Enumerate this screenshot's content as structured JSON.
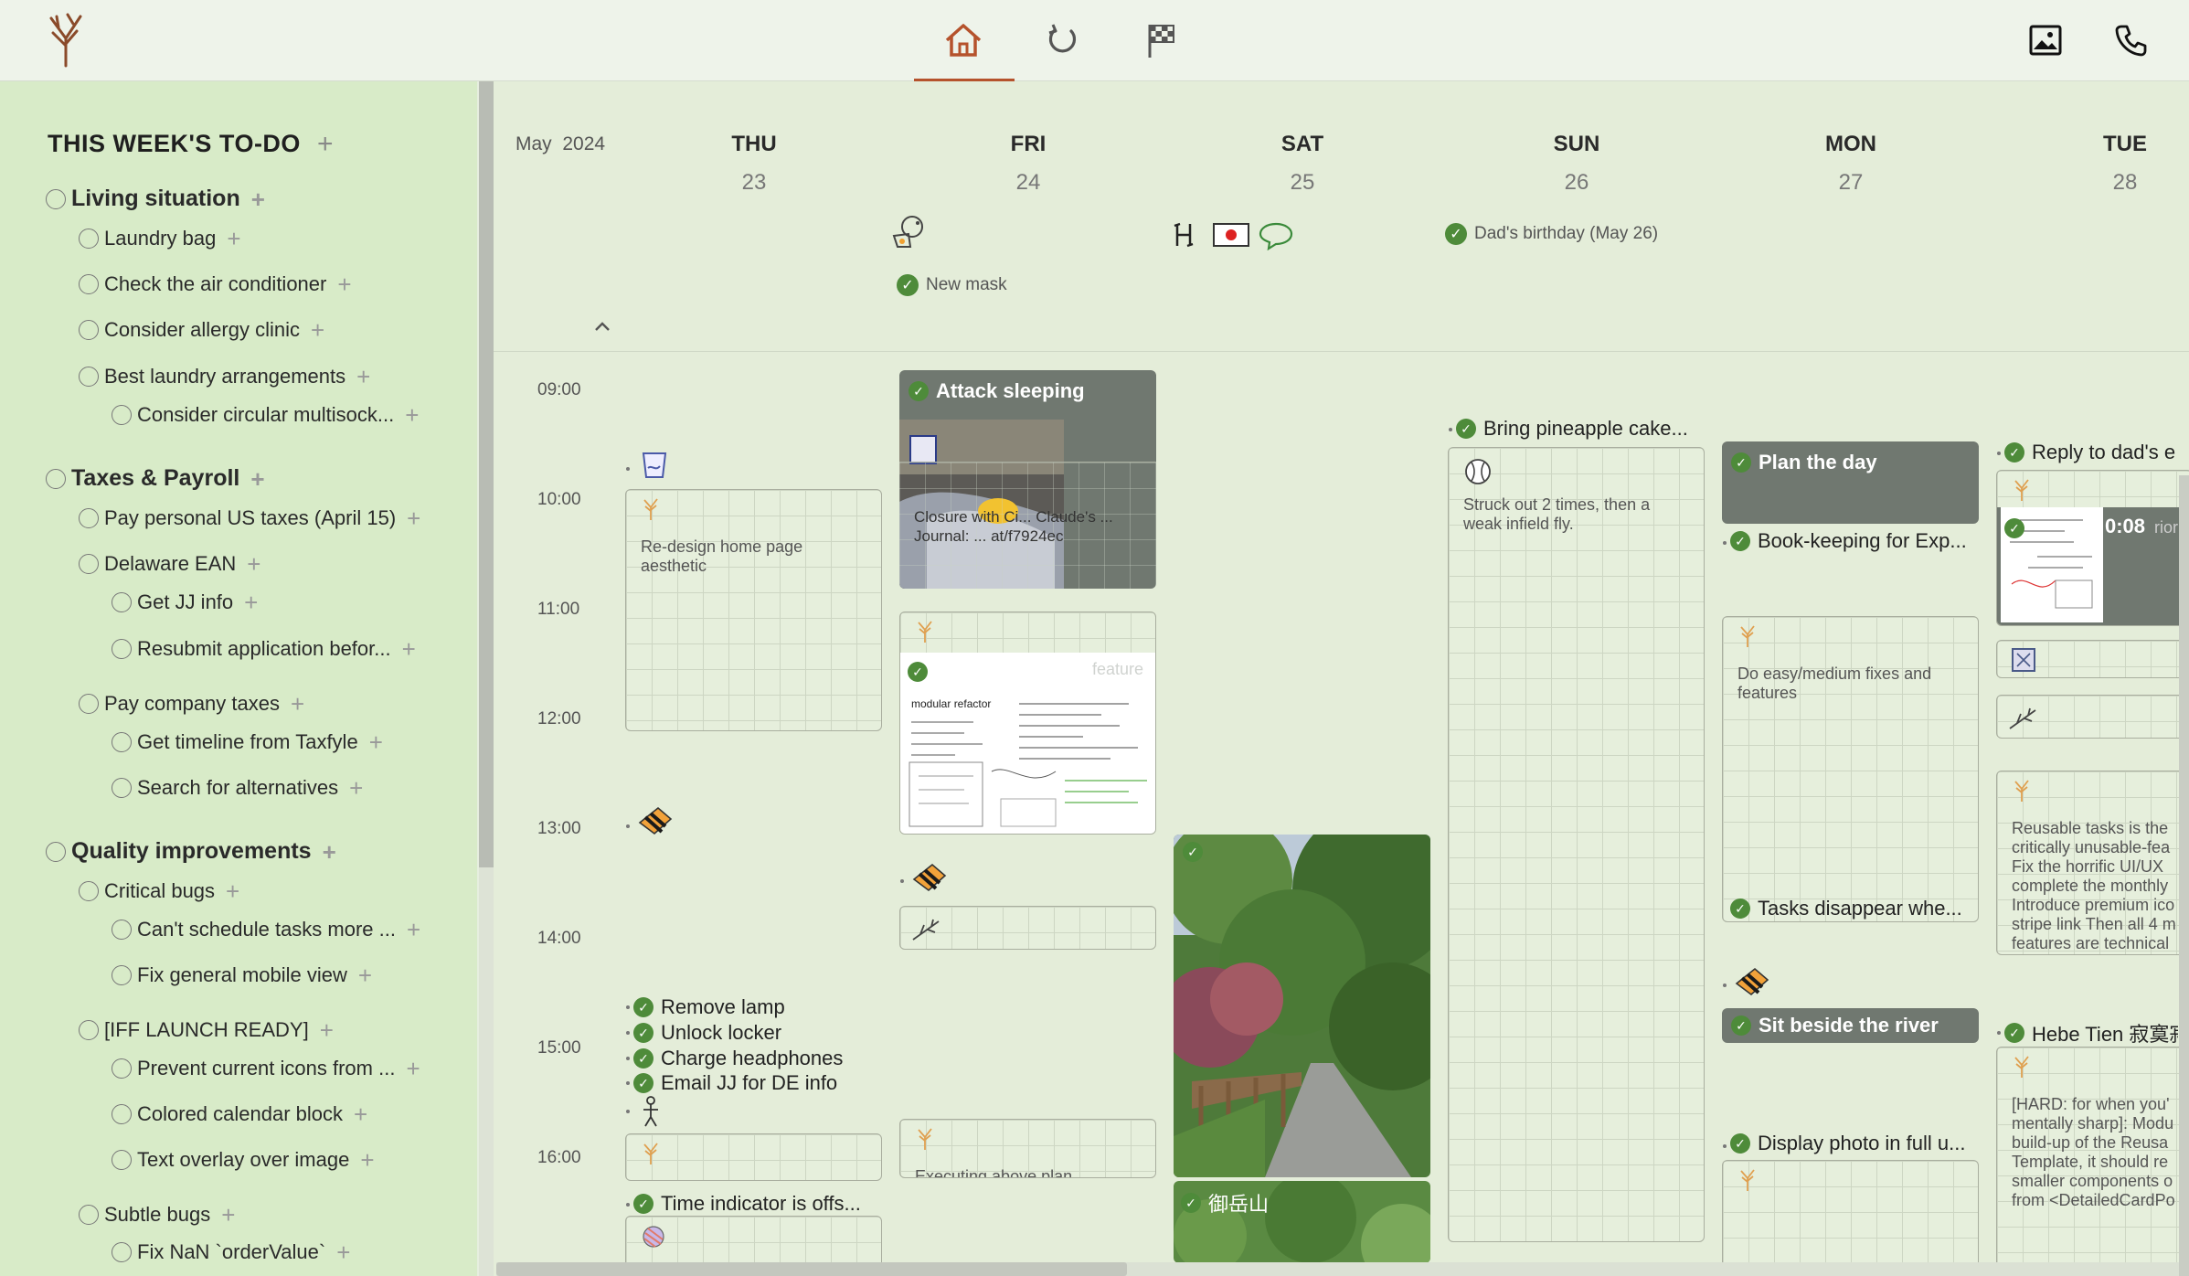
{
  "colors": {
    "accent": "#b5522c",
    "check_green": "#4e8b3a",
    "sidebar_bg": "#d8ebc8",
    "calendar_bg": "#e4edd9"
  },
  "topbar": {
    "nav": [
      "home-icon",
      "refresh-icon",
      "checkered-flag-icon"
    ],
    "right_icons": [
      "image-icon",
      "phone-icon"
    ]
  },
  "sidebar": {
    "title": "THIS WEEK'S TO-DO",
    "groups": [
      {
        "label": "Living situation",
        "items": [
          {
            "label": "Laundry bag"
          },
          {
            "label": "Check the air conditioner"
          },
          {
            "label": "Consider allergy clinic"
          },
          {
            "label": "Best laundry arrangements",
            "children": [
              {
                "label": "Consider circular multisock..."
              }
            ]
          }
        ]
      },
      {
        "label": "Taxes & Payroll",
        "items": [
          {
            "label": "Pay personal US taxes (April 15)"
          },
          {
            "label": "Delaware EAN",
            "children": [
              {
                "label": "Get JJ info"
              },
              {
                "label": "Resubmit application befor..."
              }
            ]
          },
          {
            "label": "Pay company taxes",
            "children": [
              {
                "label": "Get timeline from Taxfyle"
              },
              {
                "label": "Search for alternatives"
              }
            ]
          }
        ]
      },
      {
        "label": "Quality improvements",
        "items": [
          {
            "label": "Critical bugs",
            "children": [
              {
                "label": "Can't schedule tasks more ..."
              },
              {
                "label": "Fix general mobile view"
              }
            ]
          },
          {
            "label": "[IFF LAUNCH READY]",
            "children": [
              {
                "label": "Prevent current icons from ..."
              },
              {
                "label": "Colored calendar block"
              },
              {
                "label": "Text overlay over image"
              }
            ]
          },
          {
            "label": "Subtle bugs",
            "children": [
              {
                "label": "Fix NaN `orderValue`"
              }
            ]
          }
        ]
      }
    ]
  },
  "calendar": {
    "month": "May",
    "year": "2024",
    "days": [
      {
        "name": "THU",
        "num": "23"
      },
      {
        "name": "FRI",
        "num": "24"
      },
      {
        "name": "SAT",
        "num": "25"
      },
      {
        "name": "SUN",
        "num": "26"
      },
      {
        "name": "MON",
        "num": "27"
      },
      {
        "name": "TUE",
        "num": "28"
      }
    ],
    "times": [
      "09:00",
      "10:00",
      "11:00",
      "12:00",
      "13:00",
      "14:00",
      "15:00",
      "16:00"
    ],
    "allday": {
      "fri": "New mask",
      "sun": "Dad's birthday (May 26)"
    },
    "events": {
      "thu_redesign": "Re-design home page aesthetic",
      "thu_list": [
        "Remove lamp",
        "Unlock locker",
        "Charge headphones",
        "Email JJ for DE info"
      ],
      "thu_time_indicator": "Time indicator is offs...",
      "fri_attack": "Attack sleeping",
      "fri_overlay": "Closure with Ci... Claude's ... Journal: ... at/f7924ec",
      "fri_feature": "feature",
      "fri_executing": "Executing above plan",
      "sat_mountain": "御岳山",
      "sun_pineapple": "Bring pineapple cake...",
      "sun_baseball": "Struck out 2 times, then a weak infield fly.",
      "mon_plan": "Plan the day",
      "mon_bookkeeping": "Book-keeping for Exp...",
      "mon_fixes": "Do easy/medium fixes and features",
      "mon_tasks_disappear": "Tasks disappear whe...",
      "mon_river": "Sit beside the river",
      "mon_display_photo": "Display photo in full u...",
      "tue_reply": "Reply to dad's e",
      "tue_timer": "0:08",
      "tue_priority": "riorit",
      "tue_reusable": "Reusable tasks is the critically unusable-fea Fix the horrific UI/UX complete the monthly Introduce premium ico stripe link Then all 4 m features are technical",
      "tue_hebe": "Hebe Tien 寂寞寂",
      "tue_hard": "[HARD: for when you' mentally sharp]: Modu build-up of the Reusa Template, it should re smaller components o from <DetailedCardPo"
    }
  }
}
